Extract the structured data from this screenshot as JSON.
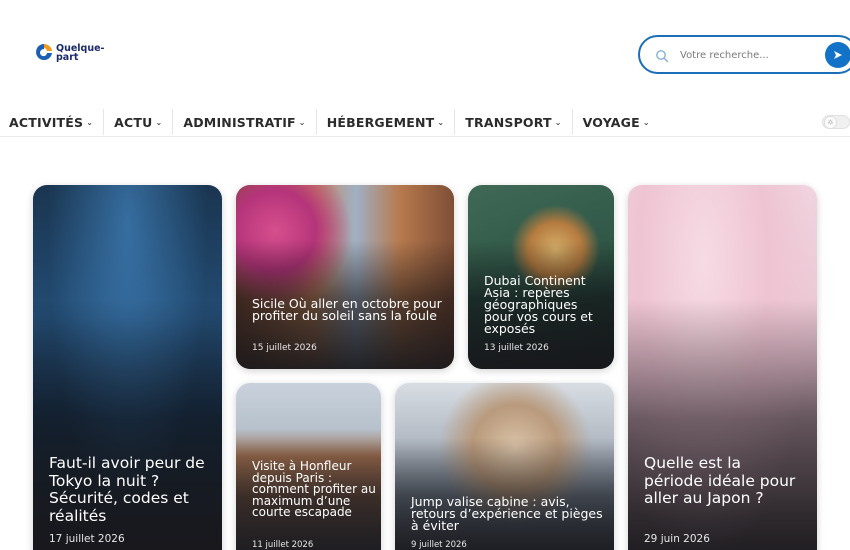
{
  "site": {
    "logo_line1": "Quelque-",
    "logo_line2": "part"
  },
  "search": {
    "placeholder": "Votre recherche..."
  },
  "nav": [
    {
      "label": "ACTIVITÉS"
    },
    {
      "label": "ACTU"
    },
    {
      "label": "ADMINISTRATIF"
    },
    {
      "label": "HÉBERGEMENT"
    },
    {
      "label": "TRANSPORT"
    },
    {
      "label": "VOYAGE"
    }
  ],
  "colors": {
    "accent": "#1272c7",
    "logo_blue": "#1a2a6b",
    "logo_orange": "#f39a1e"
  },
  "articles": [
    {
      "title": "Faut-il avoir peur de Tokyo la nuit ? Sécurité, codes et réalités",
      "date": "17 juillet 2026"
    },
    {
      "title": "Sicile Où aller en octobre pour profiter du soleil sans la foule",
      "date": "15 juillet 2026"
    },
    {
      "title": "Dubai Continent Asia : repères géographiques pour vos cours et exposés",
      "date": "13 juillet 2026"
    },
    {
      "title": "Quelle est la période idéale pour aller au Japon ?",
      "date": "29 juin 2026"
    },
    {
      "title": "Visite à Honfleur depuis Paris : comment profiter au maximum d’une courte escapade",
      "date": "11 juillet 2026"
    },
    {
      "title": "Jump valise cabine : avis, retours d’expérience et pièges à éviter",
      "date": "9 juillet 2026"
    }
  ]
}
